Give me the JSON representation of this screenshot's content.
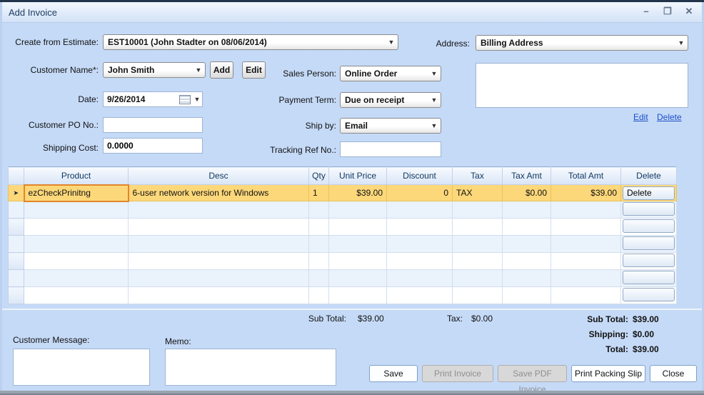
{
  "window": {
    "title": "Add Invoice",
    "minimize": "–",
    "maximize": "❐",
    "close": "✕"
  },
  "form": {
    "create_from_estimate": {
      "label": "Create from Estimate:",
      "value": "EST10001 (John Stadter on 08/06/2014)"
    },
    "address": {
      "label": "Address:",
      "value": "Billing Address",
      "text": "",
      "edit_link": "Edit",
      "delete_link": "Delete"
    },
    "customer_name": {
      "label": "Customer Name*:",
      "value": "John Smith",
      "add_button": "Add",
      "edit_button": "Edit"
    },
    "sales_person": {
      "label": "Sales Person:",
      "value": "Online Order"
    },
    "date": {
      "label": "Date:",
      "value": "9/26/2014"
    },
    "payment_term": {
      "label": "Payment Term:",
      "value": "Due on receipt"
    },
    "customer_po": {
      "label": "Customer PO No.:",
      "value": ""
    },
    "ship_by": {
      "label": "Ship by:",
      "value": "Email"
    },
    "shipping_cost": {
      "label": "Shipping Cost:",
      "value": "0.0000"
    },
    "tracking_ref": {
      "label": "Tracking Ref No.:",
      "value": ""
    }
  },
  "grid": {
    "columns": [
      "Product",
      "Desc",
      "Qty",
      "Unit Price",
      "Discount",
      "Tax",
      "Tax Amt",
      "Total Amt",
      "Delete"
    ],
    "rows": [
      {
        "product": "ezCheckPrinitng",
        "desc": "6-user network version for Windows",
        "qty": "1",
        "unit_price": "$39.00",
        "discount": "0",
        "tax": "TAX",
        "tax_amt": "$0.00",
        "total_amt": "$39.00",
        "delete_label": "Delete"
      }
    ],
    "empty_row_count": 6,
    "row_selector_glyph": "➤"
  },
  "totals": {
    "mid": {
      "sub_total_label": "Sub Total:",
      "sub_total_value": "$39.00",
      "tax_label": "Tax:",
      "tax_value": "$0.00"
    },
    "right": [
      {
        "label": "Sub Total:",
        "value": "$39.00"
      },
      {
        "label": "Shipping:",
        "value": "$0.00"
      },
      {
        "label": "Total:",
        "value": "$39.00"
      }
    ]
  },
  "bottom": {
    "customer_message_label": "Customer Message:",
    "memo_label": "Memo:",
    "buttons": [
      {
        "label": "Save",
        "enabled": true
      },
      {
        "label": "Print Invoice",
        "enabled": false
      },
      {
        "label": "Save PDF Invoice",
        "enabled": false
      },
      {
        "label": "Print Packing Slip",
        "enabled": true
      },
      {
        "label": "Close",
        "enabled": true
      }
    ]
  },
  "colors": {
    "dialog_background": "#c5daf7",
    "titlebar_gradient_top": "#f2f7fd",
    "selected_row": "#fdd87a",
    "current_cell_border": "#e1862c",
    "link_blue": "#1d4fc9",
    "grid_header_bottom": "#d8e4f6"
  }
}
